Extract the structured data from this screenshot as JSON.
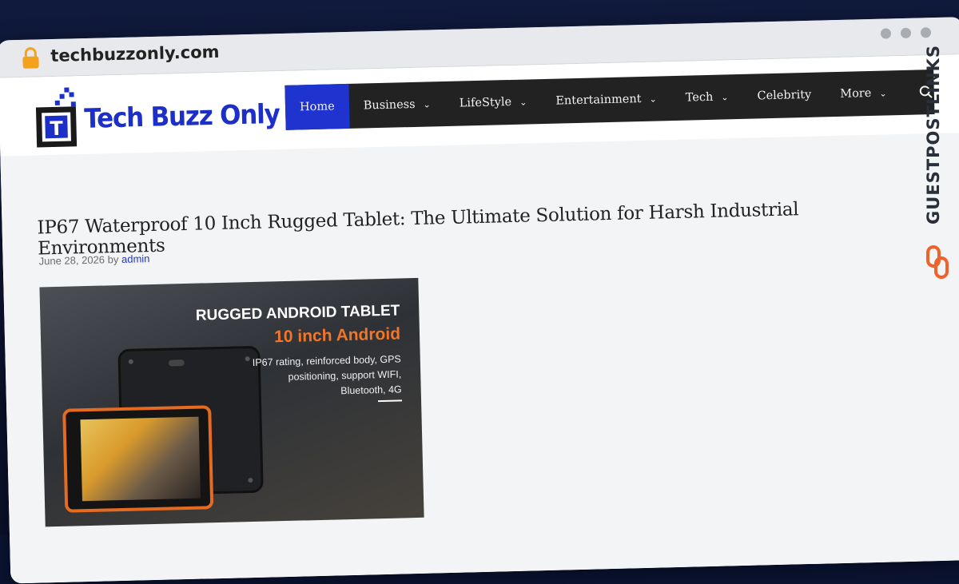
{
  "browser": {
    "url": "techbuzzonly.com"
  },
  "site": {
    "logo_text": "Tech Buzz Only",
    "logo_letter": "T",
    "accent_color": "#1f34cf",
    "nav": {
      "items": [
        {
          "label": "Home",
          "active": true,
          "dropdown": false
        },
        {
          "label": "Business",
          "active": false,
          "dropdown": true
        },
        {
          "label": "LifeStyle",
          "active": false,
          "dropdown": true
        },
        {
          "label": "Entertainment",
          "active": false,
          "dropdown": true
        },
        {
          "label": "Tech",
          "active": false,
          "dropdown": true
        },
        {
          "label": "Celebrity",
          "active": false,
          "dropdown": false
        },
        {
          "label": "More",
          "active": false,
          "dropdown": true
        }
      ],
      "search_icon": "search-icon"
    }
  },
  "article": {
    "title": "IP67 Waterproof 10 Inch Rugged Tablet: The Ultimate Solution for Harsh Industrial Environments",
    "date": "June 28, 2026",
    "by": "by",
    "author": "admin",
    "hero": {
      "line1": "RUGGED ANDROID TABLET",
      "line2": "10 inch Android",
      "line3": "IP67 rating, reinforced body, GPS positioning, support WIFI, Bluetooth, 4G"
    }
  },
  "badge": {
    "text": "GUESTPOSTLINKS",
    "color": "#f0622b"
  }
}
